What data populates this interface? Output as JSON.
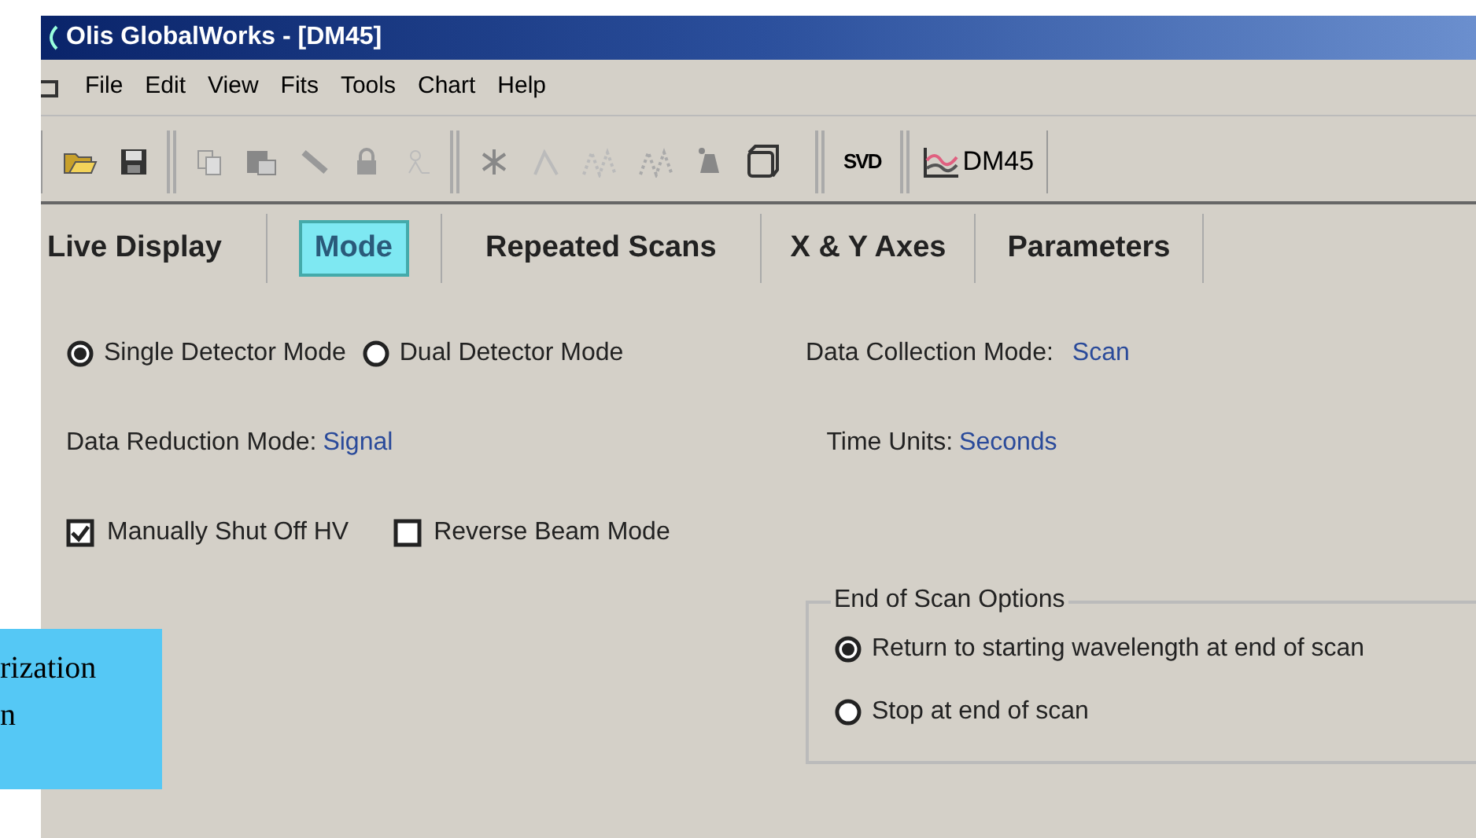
{
  "window": {
    "title": "Olis GlobalWorks - [DM45]"
  },
  "menu": [
    "File",
    "Edit",
    "View",
    "Fits",
    "Tools",
    "Chart",
    "Help"
  ],
  "toolbar": {
    "text_buttons": [
      {
        "label": "SVD"
      },
      {
        "label": "DM45"
      }
    ]
  },
  "tabs": [
    {
      "label": "Live Display",
      "selected": false
    },
    {
      "label": "Mode",
      "selected": true
    },
    {
      "label": "Repeated Scans",
      "selected": false
    },
    {
      "label": "X & Y Axes",
      "selected": false
    },
    {
      "label": "Parameters",
      "selected": false
    }
  ],
  "detector_mode": [
    {
      "label": "Single Detector Mode",
      "selected": true
    },
    {
      "label": "Dual Detector Mode",
      "selected": false
    }
  ],
  "data_collection_mode": {
    "label": "Data Collection Mode:",
    "value": "Scan"
  },
  "data_reduction_mode": {
    "label": "Data Reduction Mode:",
    "value": "Signal"
  },
  "time_units": {
    "label": "Time Units:",
    "value": "Seconds"
  },
  "checkboxes": [
    {
      "label": "Manually Shut Off HV",
      "checked": true
    },
    {
      "label": "Reverse Beam Mode",
      "checked": false
    }
  ],
  "end_of_scan_options": {
    "title": "End of Scan Options",
    "options": [
      {
        "label": "Return to starting wavelength at end of scan",
        "selected": true
      },
      {
        "label": "Stop at end of scan",
        "selected": false
      }
    ]
  },
  "callout": {
    "lines": [
      "rization",
      "n"
    ]
  }
}
